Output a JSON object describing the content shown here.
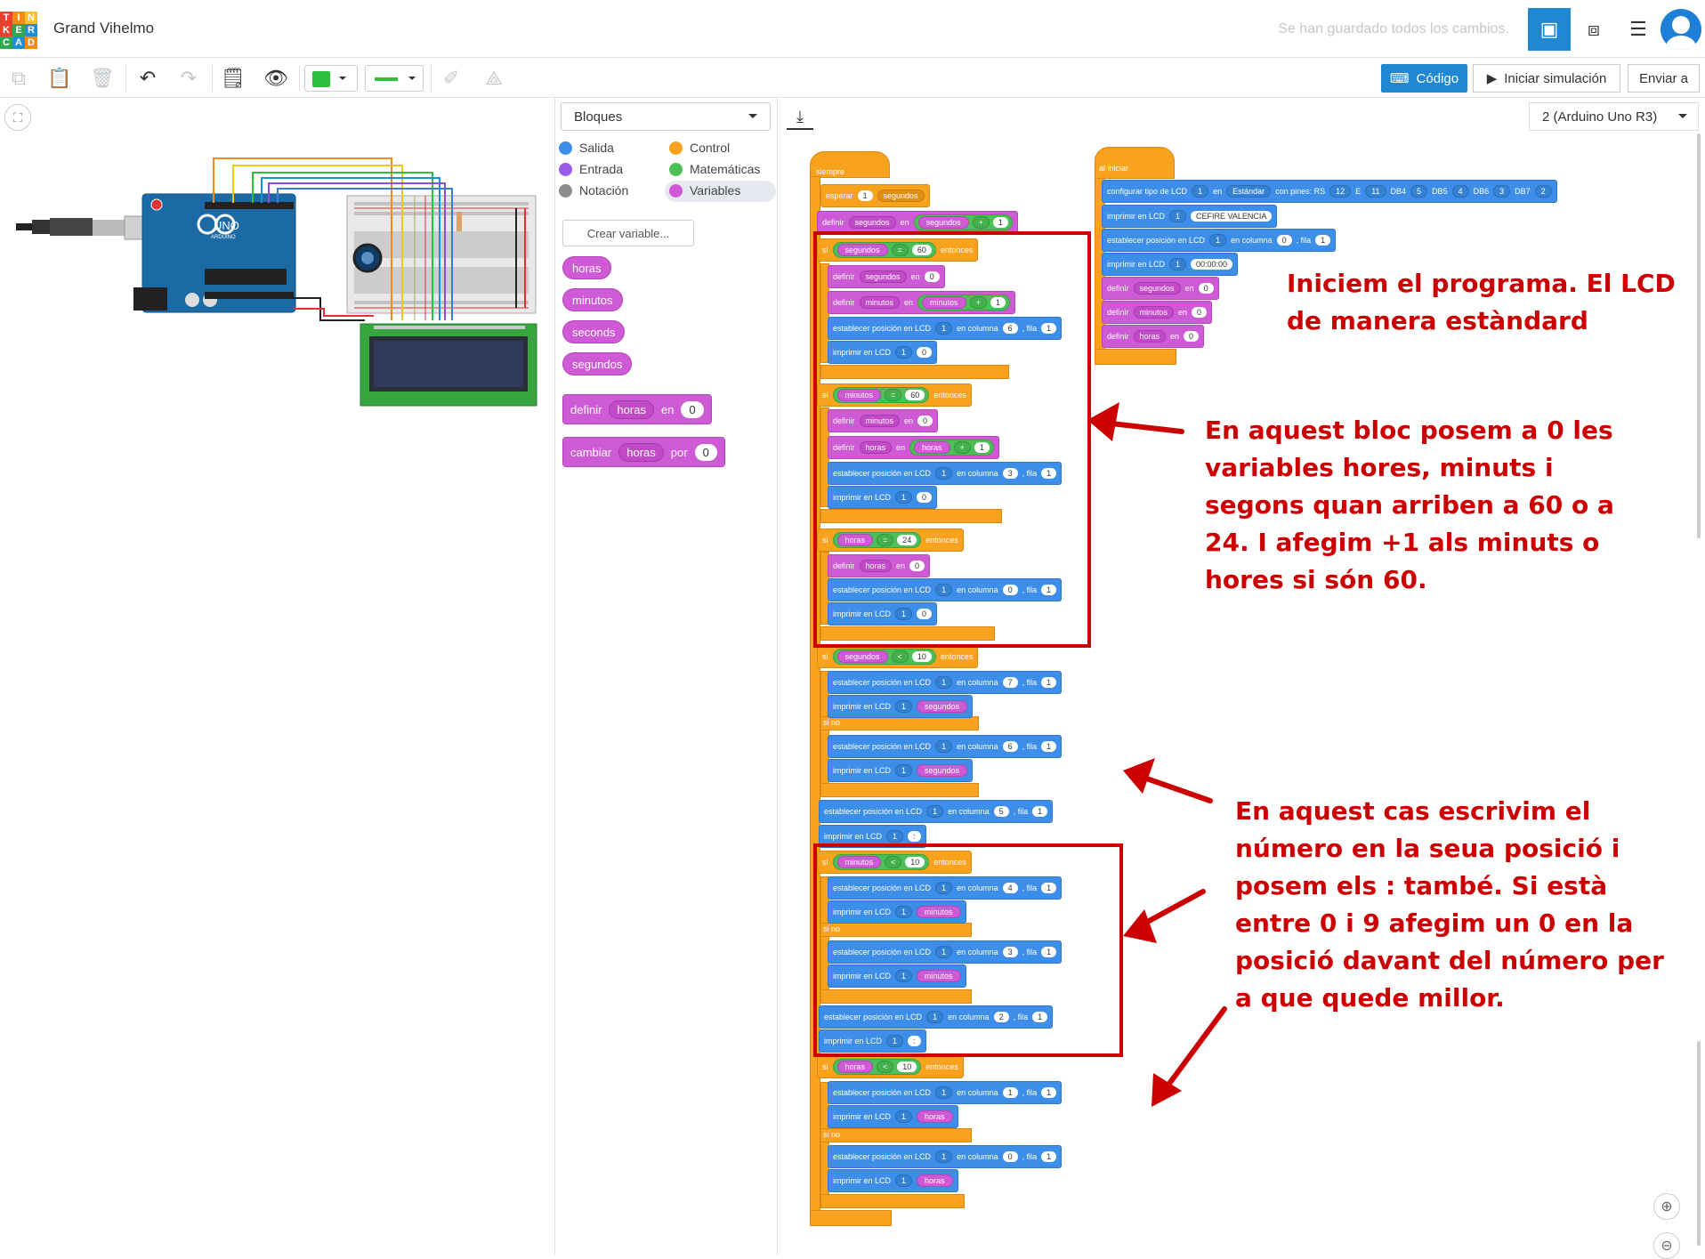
{
  "app": {
    "logo_letters": [
      "T",
      "I",
      "N",
      "K",
      "E",
      "R",
      "C",
      "A",
      "D"
    ],
    "title": "Grand Vihelmo",
    "saved_status": "Se han guardado todos los cambios."
  },
  "toolbar": {
    "code_label": "Código",
    "sim_label": "Iniciar simulación",
    "send_label": "Enviar a"
  },
  "blocks_panel": {
    "mode": "Bloques",
    "categories": [
      {
        "label": "Salida",
        "color": "#3d8ee9"
      },
      {
        "label": "Control",
        "color": "#f9a21d"
      },
      {
        "label": "Entrada",
        "color": "#9a5ce6"
      },
      {
        "label": "Matemáticas",
        "color": "#4cbf56"
      },
      {
        "label": "Notación",
        "color": "#8c8c8c"
      },
      {
        "label": "Variables",
        "color": "#cf5ad6"
      }
    ],
    "create_variable": "Crear variable...",
    "variables": [
      "horas",
      "minutos",
      "seconds",
      "segundos"
    ],
    "set_block": {
      "kw": "definir",
      "var": "horas",
      "prep": "en",
      "val": "0"
    },
    "change_block": {
      "kw": "cambiar",
      "var": "horas",
      "prep": "por",
      "val": "0"
    }
  },
  "workspace": {
    "board": "2 (Arduino Uno R3)"
  },
  "program": {
    "forever": "siempre",
    "wait": [
      "esperar",
      "1",
      "segundos"
    ],
    "set_seg": [
      "definir",
      "segundos",
      "en",
      "segundos",
      "+",
      "1"
    ],
    "if1": [
      "si",
      "segundos",
      "=",
      "60",
      "entonces"
    ],
    "if1_b1": [
      "definir",
      "segundos",
      "en",
      "0"
    ],
    "if1_b2": [
      "definir",
      "minutos",
      "en",
      "minutos",
      "+",
      "1"
    ],
    "if1_b3": [
      "establecer posición en LCD",
      "1",
      "en columna",
      "6",
      ", fila",
      "1"
    ],
    "if1_b4": [
      "imprimir en LCD",
      "1",
      "0"
    ],
    "if2": [
      "si",
      "minutos",
      "=",
      "60",
      "entonces"
    ],
    "if2_b1": [
      "definir",
      "minutos",
      "en",
      "0"
    ],
    "if2_b2": [
      "definir",
      "horas",
      "en",
      "horas",
      "+",
      "1"
    ],
    "if2_b3": [
      "establecer posición en LCD",
      "1",
      "en columna",
      "3",
      ", fila",
      "1"
    ],
    "if2_b4": [
      "imprimir en LCD",
      "1",
      "0"
    ],
    "if3": [
      "si",
      "horas",
      "=",
      "24",
      "entonces"
    ],
    "if3_b1": [
      "definir",
      "horas",
      "en",
      "0"
    ],
    "if3_b2": [
      "establecer posición en LCD",
      "1",
      "en columna",
      "0",
      ", fila",
      "1"
    ],
    "if3_b3": [
      "imprimir en LCD",
      "1",
      "0"
    ],
    "if4": [
      "si",
      "segundos",
      "<",
      "10",
      "entonces"
    ],
    "if4_b1": [
      "establecer posición en LCD",
      "1",
      "en columna",
      "7",
      ", fila",
      "1"
    ],
    "if4_b2": [
      "imprimir en LCD",
      "1",
      "segundos"
    ],
    "else_label": "si no",
    "if4_e1": [
      "establecer posición en LCD",
      "1",
      "en columna",
      "6",
      ", fila",
      "1"
    ],
    "if4_e2": [
      "imprimir en LCD",
      "1",
      "segundos"
    ],
    "pos5": [
      "establecer posición en LCD",
      "1",
      "en columna",
      "5",
      ", fila",
      "1"
    ],
    "print5": [
      "imprimir en LCD",
      "1",
      ":"
    ],
    "if5": [
      "si",
      "minutos",
      "<",
      "10",
      "entonces"
    ],
    "if5_b1": [
      "establecer posición en LCD",
      "1",
      "en columna",
      "4",
      ", fila",
      "1"
    ],
    "if5_b2": [
      "imprimir en LCD",
      "1",
      "minutos"
    ],
    "if5_e1": [
      "establecer posición en LCD",
      "1",
      "en columna",
      "3",
      ", fila",
      "1"
    ],
    "if5_e2": [
      "imprimir en LCD",
      "1",
      "minutos"
    ],
    "pos6": [
      "establecer posición en LCD",
      "1",
      "en columna",
      "2",
      ", fila",
      "1"
    ],
    "print6": [
      "imprimir en LCD",
      "1",
      ":"
    ],
    "if6": [
      "si",
      "horas",
      "<",
      "10",
      "entonces"
    ],
    "if6_b1": [
      "establecer posición en LCD",
      "1",
      "en columna",
      "1",
      ", fila",
      "1"
    ],
    "if6_b2": [
      "imprimir en LCD",
      "1",
      "horas"
    ],
    "if6_e1": [
      "establecer posición en LCD",
      "1",
      "en columna",
      "0",
      ", fila",
      "1"
    ],
    "if6_e2": [
      "imprimir en LCD",
      "1",
      "horas"
    ],
    "start": "al iniciar",
    "cfg": [
      "configurar tipo de LCD",
      "1",
      "en",
      "Estándar",
      "con pines: RS",
      "12",
      "E",
      "11",
      "DB4",
      "5",
      "DB5",
      "4",
      "DB6",
      "3",
      "DB7",
      "2"
    ],
    "s1": [
      "imprimir en LCD",
      "1",
      "CEFIRE VALENCIA"
    ],
    "s2": [
      "establecer posición en LCD",
      "1",
      "en columna",
      "0",
      ", fila",
      "1"
    ],
    "s3": [
      "imprimir en LCD",
      "1",
      "00:00:00"
    ],
    "s4": [
      "definir",
      "segundos",
      "en",
      "0"
    ],
    "s5": [
      "definir",
      "minutos",
      "en",
      "0"
    ],
    "s6": [
      "definir",
      "horas",
      "en",
      "0"
    ]
  },
  "annotations": {
    "a1": "Iniciem el programa. El LCD de manera estàndard",
    "a2": "En aquest bloc posem a 0 les variables hores, minuts i segons quan arriben a 60 o a 24. I afegim +1 als minuts o hores si són 60.",
    "a3": "En aquest cas escrivim el número en la seua posició i posem els : també. Si està entre 0 i 9 afegim un 0 en la posició davant del número per a que quede millor."
  },
  "circuit": {
    "arduino_label": "UNO",
    "arduino_brand": "ARDUINO"
  }
}
